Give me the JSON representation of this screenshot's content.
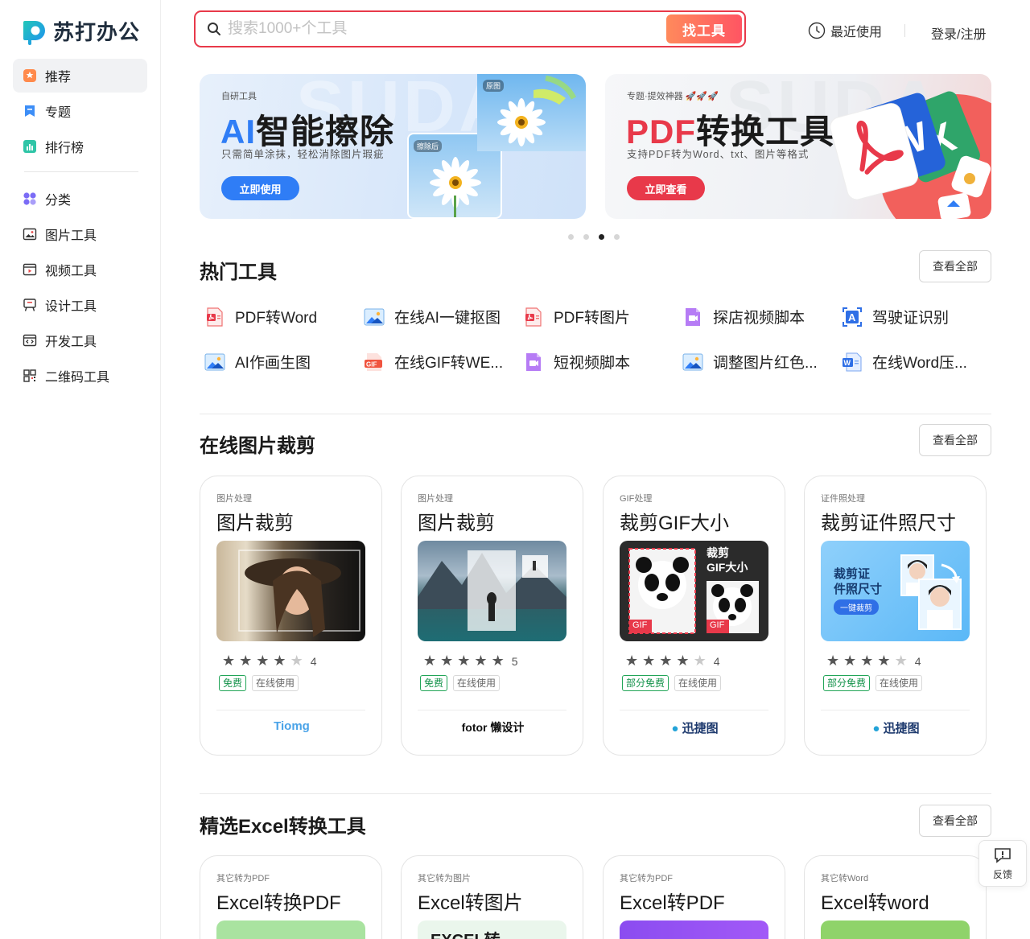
{
  "brand": {
    "name": "苏打办公"
  },
  "sidebar": {
    "items": [
      {
        "label": "推荐",
        "icon": "recommend-icon"
      },
      {
        "label": "专题",
        "icon": "topic-icon"
      },
      {
        "label": "排行榜",
        "icon": "ranking-icon"
      },
      {
        "label": "分类",
        "icon": "category-icon"
      },
      {
        "label": "图片工具",
        "icon": "image-tool-icon"
      },
      {
        "label": "视频工具",
        "icon": "video-tool-icon"
      },
      {
        "label": "设计工具",
        "icon": "design-tool-icon"
      },
      {
        "label": "开发工具",
        "icon": "dev-tool-icon"
      },
      {
        "label": "二维码工具",
        "icon": "qrcode-tool-icon"
      }
    ]
  },
  "search": {
    "placeholder": "搜索1000+个工具",
    "button": "找工具"
  },
  "header": {
    "recent": "最近使用",
    "login": "登录/注册"
  },
  "banners": [
    {
      "tag": "自研工具",
      "title_a": "AI",
      "title_b": "智能擦除",
      "subtitle": "只需简单涂抹，轻松消除图片瑕疵",
      "button": "立即使用",
      "label_before": "原图",
      "label_after": "擦除后",
      "bg_text": "SUDA"
    },
    {
      "tag": "专题·提效神器 🚀🚀🚀",
      "title_a": "PDF",
      "title_b": "转换工具",
      "subtitle": "支持PDF转为Word、txt、图片等格式",
      "button": "立即查看",
      "bg_text": "SUDA"
    }
  ],
  "carousel": {
    "count": 4,
    "active": 2
  },
  "hot": {
    "title": "热门工具",
    "more": "查看全部",
    "tools": [
      {
        "label": "PDF转Word",
        "icon": "pdf-icon"
      },
      {
        "label": "在线AI一键抠图",
        "icon": "image-icon"
      },
      {
        "label": "PDF转图片",
        "icon": "pdf-icon"
      },
      {
        "label": "探店视频脚本",
        "icon": "video-script-icon"
      },
      {
        "label": "驾驶证识别",
        "icon": "ocr-icon"
      },
      {
        "label": "AI作画生图",
        "icon": "image-icon"
      },
      {
        "label": "在线GIF转WE...",
        "icon": "gif-icon"
      },
      {
        "label": "短视频脚本",
        "icon": "video-script-icon"
      },
      {
        "label": "调整图片红色...",
        "icon": "image-icon"
      },
      {
        "label": "在线Word压...",
        "icon": "word-icon"
      }
    ]
  },
  "crop": {
    "title": "在线图片裁剪",
    "more": "查看全部",
    "cards": [
      {
        "category": "图片处理",
        "title": "图片裁剪",
        "rating": 4,
        "badges": [
          "免费",
          "在线使用"
        ],
        "source": "Tiomg"
      },
      {
        "category": "图片处理",
        "title": "图片裁剪",
        "rating": 5,
        "badges": [
          "免费",
          "在线使用"
        ],
        "source": "fotor 懒设计"
      },
      {
        "category": "GIF处理",
        "title": "裁剪GIF大小",
        "rating": 4,
        "badges": [
          "部分免费",
          "在线使用"
        ],
        "source": "迅捷图",
        "thumb_text": "裁剪\nGIF大小",
        "gif": "GIF"
      },
      {
        "category": "证件照处理",
        "title": "裁剪证件照尺寸",
        "rating": 4,
        "badges": [
          "部分免费",
          "在线使用"
        ],
        "source": "迅捷图",
        "thumb_text": "裁剪证\n件照尺寸",
        "thumb_btn": "一键裁剪"
      }
    ]
  },
  "excel": {
    "title": "精选Excel转换工具",
    "more": "查看全部",
    "cards": [
      {
        "category": "其它转为PDF",
        "title": "Excel转换PDF"
      },
      {
        "category": "其它转为图片",
        "title": "Excel转图片",
        "thumb_text": "EXCEL转"
      },
      {
        "category": "其它转为PDF",
        "title": "Excel转PDF"
      },
      {
        "category": "其它转Word",
        "title": "Excel转word"
      }
    ]
  },
  "feedback": {
    "label": "反馈"
  },
  "colors": {
    "accent": "#e8394a",
    "brand_blue": "#1e9ff2",
    "brand_teal": "#23c7b8",
    "free_green": "#13924a"
  }
}
